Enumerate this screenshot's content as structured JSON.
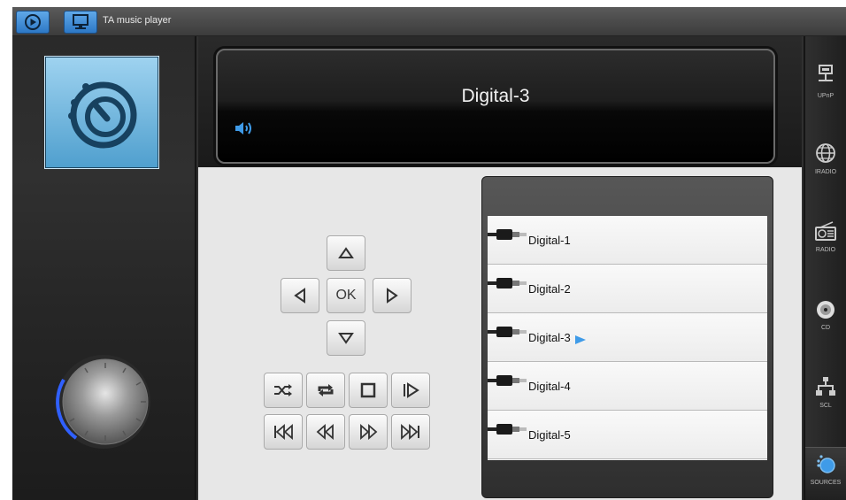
{
  "app": {
    "title": "TA music player"
  },
  "topbar": {
    "buttons": [
      {
        "icon": "play-circle-icon"
      },
      {
        "icon": "monitor-icon"
      }
    ]
  },
  "left_panel": {
    "source_icon": "sources-icon",
    "knob": "volume-knob"
  },
  "display": {
    "title": "Digital-3",
    "volume_icon": "speaker-icon"
  },
  "controls": {
    "nav": {
      "up": "up-arrow-icon",
      "left": "left-arrow-icon",
      "ok": "OK",
      "right": "right-arrow-icon",
      "down": "down-arrow-icon"
    },
    "transport_row1": [
      "shuffle-icon",
      "repeat-icon",
      "stop-icon",
      "play-pause-icon"
    ],
    "transport_row2": [
      "skip-back-icon",
      "rewind-icon",
      "fast-forward-icon",
      "skip-forward-icon"
    ]
  },
  "source_list": {
    "items": [
      {
        "label": "Digital-1",
        "selected": false
      },
      {
        "label": "Digital-2",
        "selected": false
      },
      {
        "label": "Digital-3",
        "selected": true
      },
      {
        "label": "Digital-4",
        "selected": false
      },
      {
        "label": "Digital-5",
        "selected": false
      }
    ]
  },
  "sidebar": {
    "items": [
      {
        "label": "UPnP",
        "icon": "upnp-icon",
        "active": false
      },
      {
        "label": "IRADIO",
        "icon": "globe-icon",
        "active": false
      },
      {
        "label": "RADIO",
        "icon": "radio-icon",
        "active": false
      },
      {
        "label": "CD",
        "icon": "cd-icon",
        "active": false
      },
      {
        "label": "SCL",
        "icon": "network-icon",
        "active": false
      },
      {
        "label": "SOURCES",
        "icon": "sources-icon",
        "active": true
      }
    ]
  },
  "colors": {
    "accent": "#3f9be8",
    "panel": "#1e1e1e",
    "control_bg": "#e7e7e7"
  }
}
